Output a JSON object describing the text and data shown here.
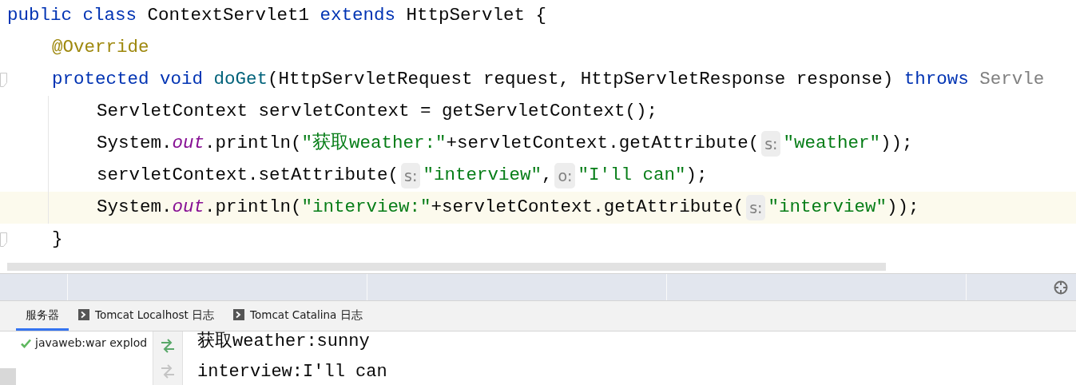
{
  "editor": {
    "lines": [
      {
        "current": false,
        "folded_marker": false,
        "parts": [
          {
            "kind": "code",
            "tokens": [
              {
                "text": "public ",
                "kind": "keyword"
              },
              {
                "text": "class",
                "kind": "keyword"
              },
              {
                "text": " ContextServlet1 ",
                "kind": "plain"
              },
              {
                "text": "extends",
                "kind": "keyword"
              },
              {
                "text": " HttpServlet {",
                "kind": "plain"
              }
            ]
          }
        ],
        "children": [
          {
            "current": false,
            "folded_marker": false,
            "parts": [
              {
                "kind": "code",
                "tokens": [
                  {
                    "text": "@Override",
                    "kind": "annotation"
                  }
                ]
              }
            ]
          },
          {
            "current": false,
            "folded_marker": true,
            "parts": [
              {
                "kind": "code",
                "tokens": [
                  {
                    "text": "protected ",
                    "kind": "keyword"
                  },
                  {
                    "text": "void ",
                    "kind": "keyword"
                  },
                  {
                    "text": "doGet",
                    "kind": "method"
                  },
                  {
                    "text": "(HttpServletRequest request, HttpServletResponse response) ",
                    "kind": "plain"
                  },
                  {
                    "text": "throws",
                    "kind": "keyword"
                  },
                  {
                    "text": " Servle",
                    "kind": "unused"
                  }
                ]
              }
            ],
            "children": [
              {
                "current": false,
                "folded_marker": false,
                "parts": [
                  {
                    "kind": "code",
                    "tokens": [
                      {
                        "text": "ServletContext servletContext = getServletContext();",
                        "kind": "plain"
                      }
                    ]
                  }
                ]
              },
              {
                "current": false,
                "folded_marker": false,
                "parts": [
                  {
                    "kind": "code",
                    "tokens": [
                      {
                        "text": "System.",
                        "kind": "plain"
                      },
                      {
                        "text": "out",
                        "kind": "static"
                      },
                      {
                        "text": ".println(",
                        "kind": "plain"
                      },
                      {
                        "text": "\"获取weather:\"",
                        "kind": "string"
                      },
                      {
                        "text": "+servletContext.getAttribute(",
                        "kind": "plain"
                      }
                    ]
                  },
                  {
                    "kind": "hint",
                    "text": "s:"
                  },
                  {
                    "kind": "code",
                    "tokens": [
                      {
                        "text": "\"weather\"",
                        "kind": "string"
                      },
                      {
                        "text": "));",
                        "kind": "plain"
                      }
                    ]
                  }
                ]
              },
              {
                "current": false,
                "folded_marker": false,
                "parts": [
                  {
                    "kind": "code",
                    "tokens": [
                      {
                        "text": "servletContext.setAttribute(",
                        "kind": "plain"
                      }
                    ]
                  },
                  {
                    "kind": "hint",
                    "text": "s:"
                  },
                  {
                    "kind": "code",
                    "tokens": [
                      {
                        "text": "\"interview\"",
                        "kind": "string"
                      },
                      {
                        "text": ",",
                        "kind": "plain"
                      }
                    ]
                  },
                  {
                    "kind": "hint",
                    "text": "o:"
                  },
                  {
                    "kind": "code",
                    "tokens": [
                      {
                        "text": "\"I'll can\"",
                        "kind": "string"
                      },
                      {
                        "text": ");",
                        "kind": "plain"
                      }
                    ]
                  }
                ]
              },
              {
                "current": true,
                "folded_marker": false,
                "parts": [
                  {
                    "kind": "code",
                    "tokens": [
                      {
                        "text": "System.",
                        "kind": "plain"
                      },
                      {
                        "text": "out",
                        "kind": "static"
                      },
                      {
                        "text": ".println(",
                        "kind": "plain"
                      },
                      {
                        "text": "\"interview:\"",
                        "kind": "string"
                      },
                      {
                        "text": "+servletContext.getAttribute(",
                        "kind": "plain"
                      }
                    ]
                  },
                  {
                    "kind": "hint",
                    "text": "s:"
                  },
                  {
                    "kind": "code",
                    "tokens": [
                      {
                        "text": "\"interview\"",
                        "kind": "string"
                      },
                      {
                        "text": "));",
                        "kind": "plain"
                      }
                    ]
                  }
                ]
              }
            ]
          },
          {
            "current": false,
            "folded_marker": true,
            "parts": [
              {
                "kind": "code",
                "tokens": [
                  {
                    "text": "}",
                    "kind": "plain"
                  }
                ]
              }
            ]
          }
        ]
      }
    ]
  },
  "tool_window": {
    "tabs": [
      {
        "label": "服务器",
        "kind": "plain",
        "selected": true
      },
      {
        "label": "Tomcat Localhost 日志",
        "kind": "log",
        "selected": false
      },
      {
        "label": "Tomcat Catalina 日志",
        "kind": "log",
        "selected": false
      }
    ],
    "servers": [
      {
        "label": "javaweb:war explod",
        "running": true
      }
    ],
    "console_actions": [
      {
        "disabled": false
      },
      {
        "disabled": true
      }
    ],
    "console": [
      "获取weather:sunny",
      "interview:I'll can"
    ]
  }
}
